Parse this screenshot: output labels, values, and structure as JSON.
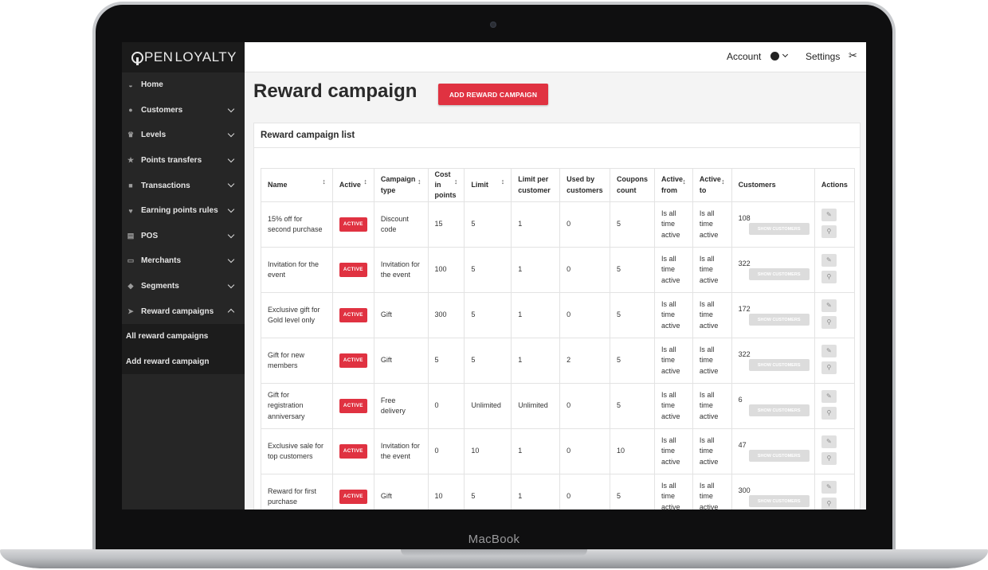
{
  "device": {
    "brand": "MacBook"
  },
  "app": {
    "logo_prefix": "PEN",
    "logo_suffix": "LOYALTY"
  },
  "sidebar": {
    "items": [
      {
        "label": "Home",
        "icon": "dashboard-icon",
        "expanded": null
      },
      {
        "label": "Customers",
        "icon": "users-icon",
        "expanded": false
      },
      {
        "label": "Levels",
        "icon": "trophy-icon",
        "expanded": false
      },
      {
        "label": "Points transfers",
        "icon": "star-icon",
        "expanded": false
      },
      {
        "label": "Transactions",
        "icon": "bag-icon",
        "expanded": false
      },
      {
        "label": "Earning points rules",
        "icon": "heart-icon",
        "expanded": false
      },
      {
        "label": "POS",
        "icon": "pos-icon",
        "expanded": false
      },
      {
        "label": "Merchants",
        "icon": "id-card-icon",
        "expanded": false
      },
      {
        "label": "Segments",
        "icon": "tag-icon",
        "expanded": false
      },
      {
        "label": "Reward campaigns",
        "icon": "send-icon",
        "expanded": true
      }
    ],
    "subitems": [
      {
        "label": "All reward campaigns"
      },
      {
        "label": "Add reward campaign"
      }
    ]
  },
  "topbar": {
    "account_label": "Account",
    "settings_label": "Settings"
  },
  "page": {
    "title": "Reward campaign",
    "add_button": "ADD REWARD CAMPAIGN"
  },
  "list": {
    "title": "Reward campaign list",
    "columns": [
      "Name",
      "Active",
      "Campaign type",
      "Cost in points",
      "Limit",
      "Limit per customer",
      "Used by customers",
      "Coupons count",
      "Active from",
      "Active to",
      "Customers",
      "Actions"
    ],
    "show_customers_label": "SHOW CUSTOMERS",
    "rows": [
      {
        "name": "15% off for second purchase",
        "active": "ACTIVE",
        "type": "Discount code",
        "cost": "15",
        "limit": "5",
        "limit_per_customer": "1",
        "used": "0",
        "coupons": "5",
        "from": "Is all time active",
        "to": "Is all time active",
        "customers": "108"
      },
      {
        "name": "Invitation for the event",
        "active": "ACTIVE",
        "type": "Invitation for the event",
        "cost": "100",
        "limit": "5",
        "limit_per_customer": "1",
        "used": "0",
        "coupons": "5",
        "from": "Is all time active",
        "to": "Is all time active",
        "customers": "322"
      },
      {
        "name": "Exclusive gift for Gold level only",
        "active": "ACTIVE",
        "type": "Gift",
        "cost": "300",
        "limit": "5",
        "limit_per_customer": "1",
        "used": "0",
        "coupons": "5",
        "from": "Is all time active",
        "to": "Is all time active",
        "customers": "172"
      },
      {
        "name": "Gift for new members",
        "active": "ACTIVE",
        "type": "Gift",
        "cost": "5",
        "limit": "5",
        "limit_per_customer": "1",
        "used": "2",
        "coupons": "5",
        "from": "Is all time active",
        "to": "Is all time active",
        "customers": "322"
      },
      {
        "name": "Gift for registration anniversary",
        "active": "ACTIVE",
        "type": "Free delivery",
        "cost": "0",
        "limit": "Unlimited",
        "limit_per_customer": "Unlimited",
        "used": "0",
        "coupons": "5",
        "from": "Is all time active",
        "to": "Is all time active",
        "customers": "6"
      },
      {
        "name": "Exclusive sale for top customers",
        "active": "ACTIVE",
        "type": "Invitation for the event",
        "cost": "0",
        "limit": "10",
        "limit_per_customer": "1",
        "used": "0",
        "coupons": "10",
        "from": "Is all time active",
        "to": "Is all time active",
        "customers": "47"
      },
      {
        "name": "Reward for first purchase",
        "active": "ACTIVE",
        "type": "Gift",
        "cost": "10",
        "limit": "5",
        "limit_per_customer": "1",
        "used": "0",
        "coupons": "5",
        "from": "Is all time active",
        "to": "Is all time active",
        "customers": "300"
      }
    ]
  },
  "colors": {
    "accent": "#e03241",
    "sidebar_bg": "#262626",
    "content_bg": "#f4f4f4"
  }
}
